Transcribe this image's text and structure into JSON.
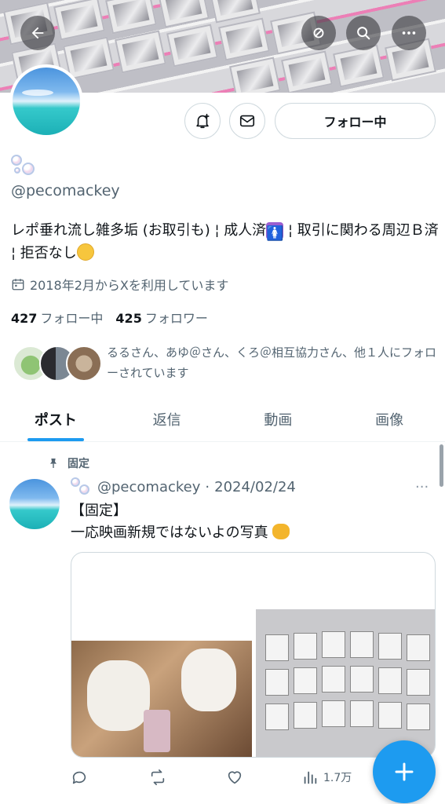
{
  "profile": {
    "handle": "@pecomackey",
    "bio_part1": "レポ垂れ流し雑多垢 (お取引も) ¦ 成人済",
    "bio_part2": " ¦ 取引に関わる周辺Ｂ済 ¦ 拒否なし",
    "joined": "2018年2月からXを利用しています",
    "following_count": "427",
    "following_label": "フォロー中",
    "followers_count": "425",
    "followers_label": "フォロワー",
    "followed_by": "るるさん、あゆ＠さん、くろ＠相互協力さん、他１人にフォローされています"
  },
  "buttons": {
    "follow": "フォロー中"
  },
  "tabs": [
    {
      "label": "ポスト",
      "active": true
    },
    {
      "label": "返信",
      "active": false
    },
    {
      "label": "動画",
      "active": false
    },
    {
      "label": "画像",
      "active": false
    }
  ],
  "post": {
    "pinned_label": "固定",
    "handle": "@pecomackey",
    "separator": "·",
    "date": "2024/02/24",
    "more": "···",
    "line1": "【固定】",
    "line2": "一応映画新規ではないよの写真",
    "views": "1.7万"
  },
  "icons": {
    "back": "arrow-left-icon",
    "translate": "translate-icon",
    "search": "search-icon",
    "more": "more-icon",
    "notify": "bell-plus-icon",
    "message": "envelope-icon",
    "calendar": "calendar-icon",
    "pin": "pin-icon",
    "reply": "reply-icon",
    "repost": "repost-icon",
    "like": "heart-icon",
    "views": "views-icon",
    "compose": "plus-icon"
  },
  "colors": {
    "accent": "#1d9bf0",
    "text": "#0f1419",
    "muted": "#536471"
  }
}
